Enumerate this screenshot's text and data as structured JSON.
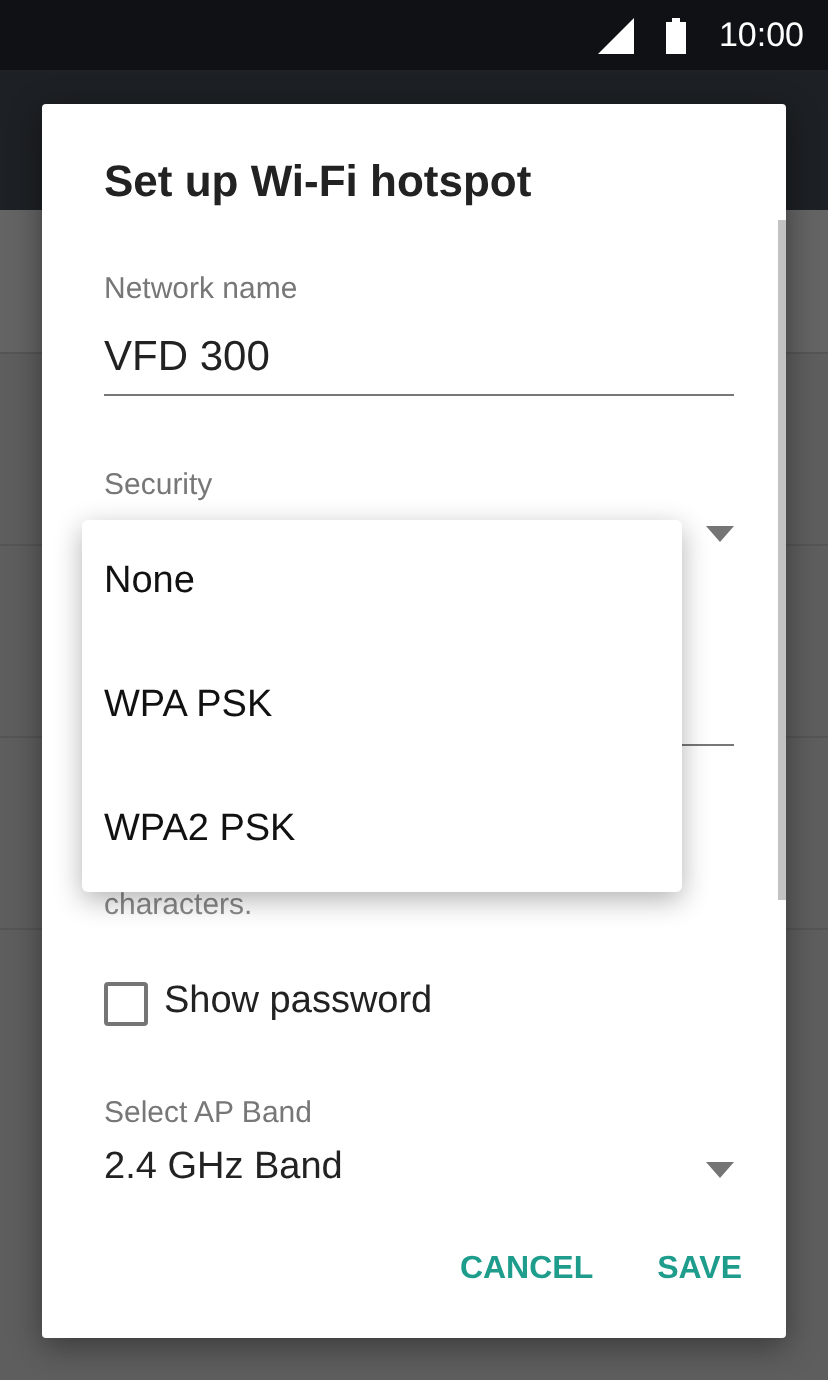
{
  "status_bar": {
    "time": "10:00"
  },
  "dialog": {
    "title": "Set up Wi-Fi hotspot",
    "network_name": {
      "label": "Network name",
      "value": "VFD 300"
    },
    "security": {
      "label": "Security"
    },
    "password": {
      "hint": "characters."
    },
    "show_password": {
      "label": "Show password",
      "checked": false
    },
    "ap_band": {
      "label": "Select AP Band",
      "value": "2.4 GHz Band"
    },
    "buttons": [
      "CANCEL",
      "SAVE"
    ]
  },
  "security_menu": {
    "items": [
      "None",
      "WPA PSK",
      "WPA2 PSK"
    ]
  }
}
